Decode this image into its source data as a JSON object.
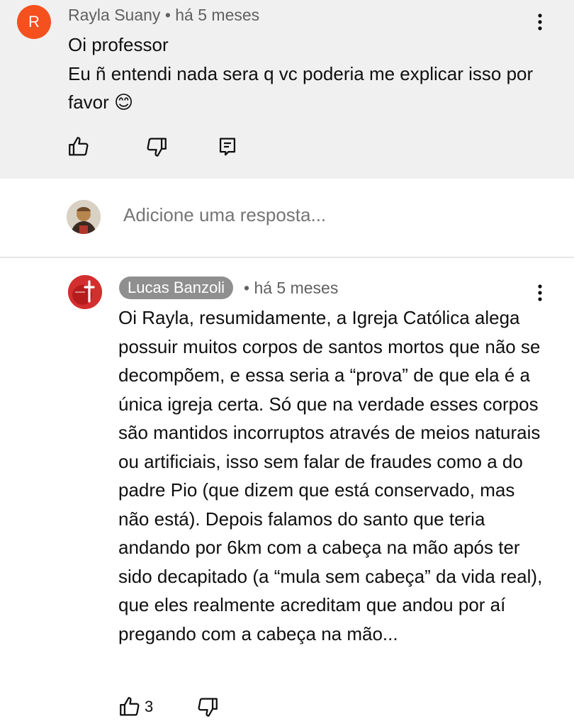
{
  "comment": {
    "avatar_letter": "R",
    "author": "Rayla Suany",
    "time": "há 5 meses",
    "lines": [
      "Oi professor",
      "Eu ñ entendi nada sera q vc poderia me explicar isso por favor 😊"
    ]
  },
  "reply_box": {
    "placeholder": "Adicione uma resposta..."
  },
  "reply": {
    "author": "Lucas Banzoli",
    "time": "há 5 meses",
    "text": "Oi Rayla, resumidamente, a Igreja Católica alega possuir muitos corpos de santos mortos que não se decompõem, e essa seria a “prova” de que ela é a única igreja certa. Só que na verdade esses corpos são mantidos incorruptos através de meios naturais ou artificiais, isso sem falar de fraudes como a do padre Pio (que dizem que está conservado, mas não está). Depois falamos do santo que teria andando por 6km com a cabeça na mão após ter sido decapitado (a “mula sem cabeça” da vida real), que eles realmente acreditam que andou por aí pregando com a cabeça na mão...",
    "likes": "3"
  },
  "icons": {
    "like": "thumbs-up-icon",
    "dislike": "thumbs-down-icon",
    "reply": "comment-reply-icon",
    "more": "more-vert-icon"
  },
  "colors": {
    "avatar_r": "#f4511e",
    "top_bg": "#f0f0f0",
    "author_badge": "#8f8f8f",
    "meta_text": "#606060"
  }
}
